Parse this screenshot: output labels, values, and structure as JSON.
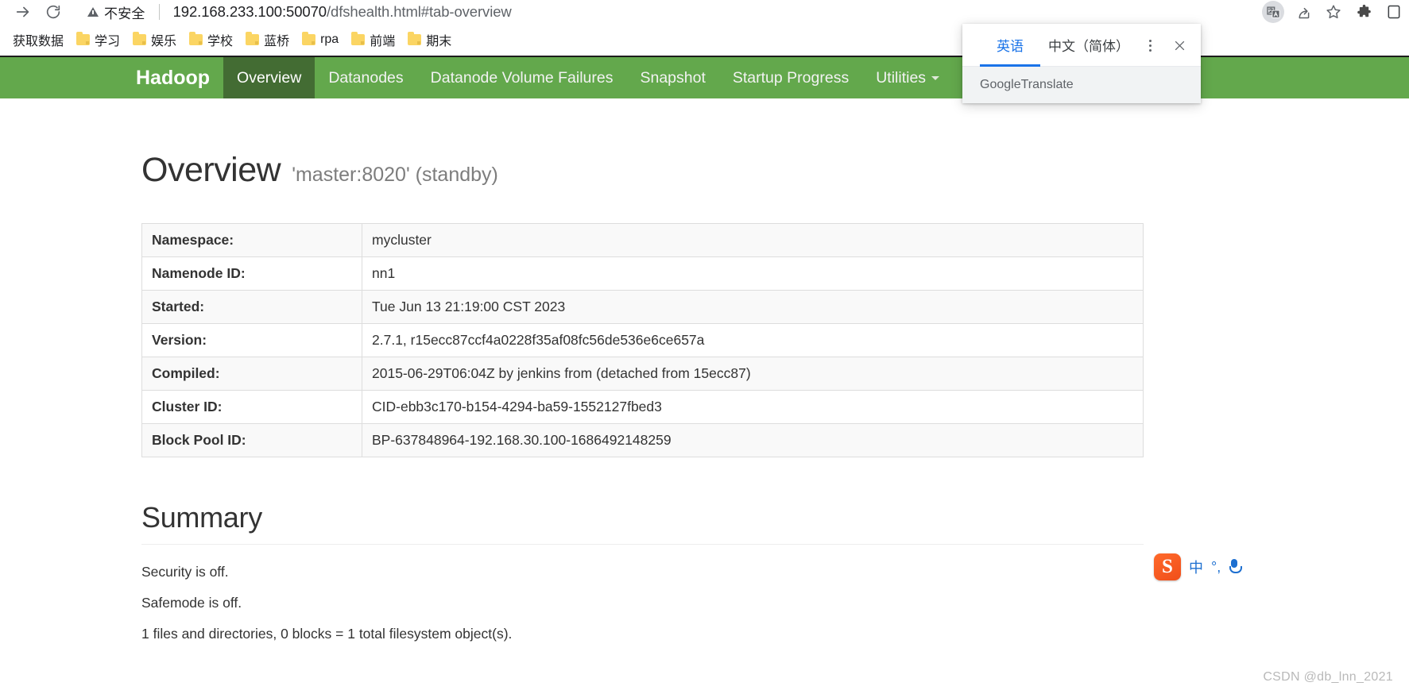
{
  "browser": {
    "nav": {
      "forward_icon": "arrow-right-icon",
      "reload_icon": "reload-icon"
    },
    "omnibox": {
      "security_label": "不安全",
      "url_host": "192.168.233.100:50070",
      "url_path": "/dfshealth.html#tab-overview",
      "url_full": "192.168.233.100:50070/dfshealth.html#tab-overview"
    },
    "toolbar_icons": [
      "translate-icon",
      "share-icon",
      "bookmark-star-icon",
      "extensions-puzzle-icon",
      "profile-icon"
    ],
    "bookmarks": [
      {
        "label": "获取数据",
        "has_folder": false
      },
      {
        "label": "学习",
        "has_folder": true
      },
      {
        "label": "娱乐",
        "has_folder": true
      },
      {
        "label": "学校",
        "has_folder": true
      },
      {
        "label": "蓝桥",
        "has_folder": true
      },
      {
        "label": "rpa",
        "has_folder": true
      },
      {
        "label": "前端",
        "has_folder": true
      },
      {
        "label": "期末",
        "has_folder": true
      }
    ]
  },
  "translate_popup": {
    "tab_source": "英语",
    "tab_target": "中文（简体）",
    "menu_icon": "kebab-menu-icon",
    "close_icon": "close-icon",
    "footer_brand_g": "Google",
    "footer_brand_rest": " Translate",
    "accent_color": "#1a73e8"
  },
  "hadoop": {
    "brand": "Hadoop",
    "navbar_color": "#63a84c",
    "navbar_active_color": "#436c33",
    "nav_items": [
      {
        "label": "Overview",
        "active": true,
        "caret": false
      },
      {
        "label": "Datanodes",
        "active": false,
        "caret": false
      },
      {
        "label": "Datanode Volume Failures",
        "active": false,
        "caret": false
      },
      {
        "label": "Snapshot",
        "active": false,
        "caret": false
      },
      {
        "label": "Startup Progress",
        "active": false,
        "caret": false
      },
      {
        "label": "Utilities",
        "active": false,
        "caret": true
      }
    ],
    "page_title": "Overview",
    "page_subtitle": "'master:8020' (standby)",
    "info_rows": [
      {
        "key": "Namespace:",
        "value": "mycluster"
      },
      {
        "key": "Namenode ID:",
        "value": "nn1"
      },
      {
        "key": "Started:",
        "value": "Tue Jun 13 21:19:00 CST 2023"
      },
      {
        "key": "Version:",
        "value": "2.7.1, r15ecc87ccf4a0228f35af08fc56de536e6ce657a"
      },
      {
        "key": "Compiled:",
        "value": "2015-06-29T06:04Z by jenkins from (detached from 15ecc87)"
      },
      {
        "key": "Cluster ID:",
        "value": "CID-ebb3c170-b154-4294-ba59-1552127fbed3"
      },
      {
        "key": "Block Pool ID:",
        "value": "BP-637848964-192.168.30.100-1686492148259"
      }
    ],
    "summary_heading": "Summary",
    "summary_lines": [
      "Security is off.",
      "Safemode is off.",
      "1 files and directories, 0 blocks = 1 total filesystem object(s)."
    ]
  },
  "ime": {
    "logo_letter": "S",
    "mode_label": "中",
    "punctuation_label": "°,",
    "mic_icon": "microphone-icon"
  },
  "watermark": "CSDN @db_lnn_2021"
}
